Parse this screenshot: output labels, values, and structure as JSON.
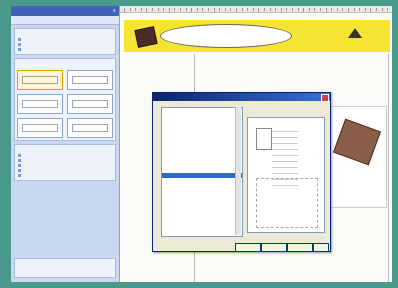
{
  "ruler_ticks": 48,
  "pane": {
    "sections": [
      {
        "title": "",
        "links": [
          "",
          "",
          ""
        ]
      },
      {
        "title": "",
        "links": [],
        "thumbs": 6
      },
      {
        "title": "",
        "links": [
          "",
          "",
          "",
          "",
          ""
        ]
      }
    ]
  },
  "document": {
    "banner_title": "",
    "heading": "",
    "caption": ""
  },
  "dialog": {
    "title": "",
    "tree_items": [
      "",
      "",
      "",
      "",
      "",
      "",
      "",
      "",
      "",
      "",
      "",
      "",
      "",
      "",
      "",
      "",
      "",
      "",
      "",
      "",
      "",
      "",
      ""
    ],
    "selected_index": 13,
    "buttons": [
      "",
      "",
      "",
      ""
    ]
  }
}
